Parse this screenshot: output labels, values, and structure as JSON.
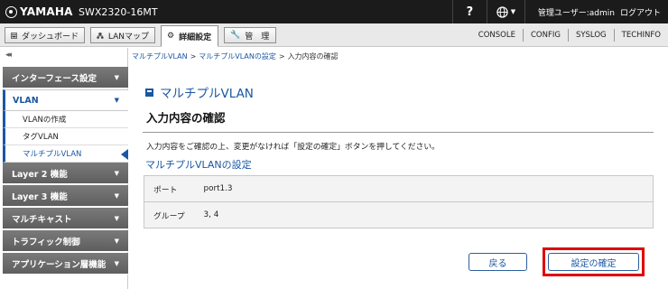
{
  "header": {
    "brand": "YAMAHA",
    "model": "SWX2320-16MT",
    "help_label": "?",
    "user_label": "管理ユーザー:admin",
    "logout_label": "ログアウト"
  },
  "nav": {
    "tabs": [
      {
        "label": "ダッシュボード",
        "icon": "dashboard-icon"
      },
      {
        "label": "LANマップ",
        "icon": "lan-map-icon"
      },
      {
        "label": "詳細設定",
        "icon": "gear-icon"
      },
      {
        "label": "管　理",
        "icon": "wrench-icon"
      }
    ],
    "active_tab": "詳細設定",
    "links": [
      "CONSOLE",
      "CONFIG",
      "SYSLOG",
      "TECHINFO"
    ]
  },
  "sidebar": {
    "collapse_label": "◂◂",
    "categories": [
      {
        "label": "インターフェース設定"
      },
      {
        "label": "VLAN",
        "children": [
          "VLANの作成",
          "タグVLAN",
          "マルチプルVLAN"
        ]
      },
      {
        "label": "Layer 2 機能"
      },
      {
        "label": "Layer 3 機能"
      },
      {
        "label": "マルチキャスト"
      },
      {
        "label": "トラフィック制御"
      },
      {
        "label": "アプリケーション層機能"
      }
    ],
    "current_item": "マルチプルVLAN"
  },
  "breadcrumb": {
    "items": [
      "マルチプルVLAN",
      "マルチプルVLANの設定",
      "入力内容の確認"
    ],
    "separator": ">"
  },
  "main": {
    "page_title": "マルチプルVLAN",
    "section_title": "入力内容の確認",
    "instruction": "入力内容をご確認の上、変更がなければ「設定の確定」ボタンを押してください。",
    "subsection_title": "マルチプルVLANの設定",
    "rows": [
      {
        "key": "ポート",
        "value": "port1.3"
      },
      {
        "key": "グループ",
        "value": "3, 4"
      }
    ],
    "back_label": "戻る",
    "confirm_label": "設定の確定"
  },
  "colors": {
    "accent": "#1a57a4",
    "topbar": "#1b1b1b",
    "highlight": "#e00000"
  }
}
